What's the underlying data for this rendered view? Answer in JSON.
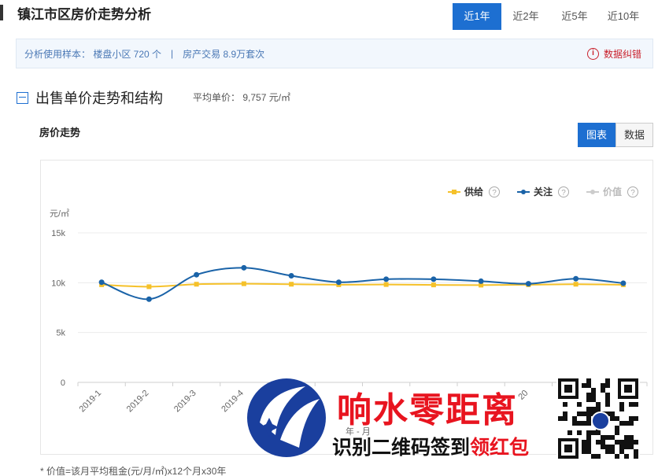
{
  "header": {
    "title": "镇江市区房价走势分析",
    "range_tabs": [
      "近1年",
      "近2年",
      "近5年",
      "近10年"
    ],
    "active_range": "近1年"
  },
  "info_bar": {
    "sample_text": "分析使用样本：  楼盘小区 720 个",
    "separator": "|",
    "trade_text": "房产交易 8.9万套次",
    "report_label": "数据纠错",
    "report_icon": "alert-circle-icon"
  },
  "section": {
    "title": "出售单价走势和结构",
    "avg_price": "平均单价：  9,757 元/㎡",
    "collapse_icon": "collapse-minus-icon"
  },
  "trend": {
    "title": "房价走势",
    "view_tabs": [
      "图表",
      "数据"
    ],
    "active_view": "图表"
  },
  "footnote": "* 价值=该月平均租金(元/月/㎡)x12个月x30年",
  "watermark": {
    "line1": "响水零距离",
    "line2_black": "识别二维码签到",
    "line2_red": "领红包"
  },
  "chart_data": {
    "type": "line",
    "ylabel": "元/㎡",
    "xlabel": "年 - 月",
    "ylim": [
      0,
      15000
    ],
    "y_ticks": [
      "0",
      "5k",
      "10k",
      "15k"
    ],
    "y_tick_values": [
      0,
      5000,
      10000,
      15000
    ],
    "grid": true,
    "legend_position": "top-right",
    "x": [
      "2019-1",
      "2019-2",
      "2019-3",
      "2019-4",
      "2019-5",
      "2019-6",
      "2019-7",
      "2019-8",
      "2019-9",
      "2019-10",
      "2019-11",
      "2019-12"
    ],
    "x_labels_visible": [
      "2019-1",
      "2019-2",
      "2019-3",
      "2019-4",
      "",
      "",
      "",
      "",
      "",
      "20",
      "",
      ""
    ],
    "series": [
      {
        "name": "供给",
        "color": "#f5c12a",
        "marker": "square",
        "values": [
          9800,
          9600,
          9850,
          9900,
          9850,
          9800,
          9820,
          9780,
          9760,
          9800,
          9850,
          9800
        ]
      },
      {
        "name": "关注",
        "color": "#1a63a8",
        "marker": "circle",
        "values": [
          10050,
          8350,
          10800,
          11500,
          10700,
          10050,
          10350,
          10350,
          10150,
          9900,
          10400,
          9950
        ]
      },
      {
        "name": "价值",
        "color": "#cccccc",
        "marker": "circle",
        "values": []
      }
    ]
  }
}
